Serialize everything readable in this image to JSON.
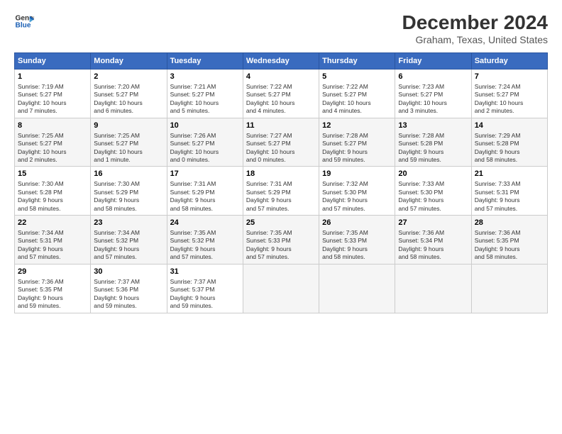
{
  "logo": {
    "line1": "General",
    "line2": "Blue"
  },
  "title": "December 2024",
  "subtitle": "Graham, Texas, United States",
  "days_of_week": [
    "Sunday",
    "Monday",
    "Tuesday",
    "Wednesday",
    "Thursday",
    "Friday",
    "Saturday"
  ],
  "weeks": [
    [
      {
        "day": "1",
        "info": "Sunrise: 7:19 AM\nSunset: 5:27 PM\nDaylight: 10 hours\nand 7 minutes."
      },
      {
        "day": "2",
        "info": "Sunrise: 7:20 AM\nSunset: 5:27 PM\nDaylight: 10 hours\nand 6 minutes."
      },
      {
        "day": "3",
        "info": "Sunrise: 7:21 AM\nSunset: 5:27 PM\nDaylight: 10 hours\nand 5 minutes."
      },
      {
        "day": "4",
        "info": "Sunrise: 7:22 AM\nSunset: 5:27 PM\nDaylight: 10 hours\nand 4 minutes."
      },
      {
        "day": "5",
        "info": "Sunrise: 7:22 AM\nSunset: 5:27 PM\nDaylight: 10 hours\nand 4 minutes."
      },
      {
        "day": "6",
        "info": "Sunrise: 7:23 AM\nSunset: 5:27 PM\nDaylight: 10 hours\nand 3 minutes."
      },
      {
        "day": "7",
        "info": "Sunrise: 7:24 AM\nSunset: 5:27 PM\nDaylight: 10 hours\nand 2 minutes."
      }
    ],
    [
      {
        "day": "8",
        "info": "Sunrise: 7:25 AM\nSunset: 5:27 PM\nDaylight: 10 hours\nand 2 minutes."
      },
      {
        "day": "9",
        "info": "Sunrise: 7:25 AM\nSunset: 5:27 PM\nDaylight: 10 hours\nand 1 minute."
      },
      {
        "day": "10",
        "info": "Sunrise: 7:26 AM\nSunset: 5:27 PM\nDaylight: 10 hours\nand 0 minutes."
      },
      {
        "day": "11",
        "info": "Sunrise: 7:27 AM\nSunset: 5:27 PM\nDaylight: 10 hours\nand 0 minutes."
      },
      {
        "day": "12",
        "info": "Sunrise: 7:28 AM\nSunset: 5:27 PM\nDaylight: 9 hours\nand 59 minutes."
      },
      {
        "day": "13",
        "info": "Sunrise: 7:28 AM\nSunset: 5:28 PM\nDaylight: 9 hours\nand 59 minutes."
      },
      {
        "day": "14",
        "info": "Sunrise: 7:29 AM\nSunset: 5:28 PM\nDaylight: 9 hours\nand 58 minutes."
      }
    ],
    [
      {
        "day": "15",
        "info": "Sunrise: 7:30 AM\nSunset: 5:28 PM\nDaylight: 9 hours\nand 58 minutes."
      },
      {
        "day": "16",
        "info": "Sunrise: 7:30 AM\nSunset: 5:29 PM\nDaylight: 9 hours\nand 58 minutes."
      },
      {
        "day": "17",
        "info": "Sunrise: 7:31 AM\nSunset: 5:29 PM\nDaylight: 9 hours\nand 58 minutes."
      },
      {
        "day": "18",
        "info": "Sunrise: 7:31 AM\nSunset: 5:29 PM\nDaylight: 9 hours\nand 57 minutes."
      },
      {
        "day": "19",
        "info": "Sunrise: 7:32 AM\nSunset: 5:30 PM\nDaylight: 9 hours\nand 57 minutes."
      },
      {
        "day": "20",
        "info": "Sunrise: 7:33 AM\nSunset: 5:30 PM\nDaylight: 9 hours\nand 57 minutes."
      },
      {
        "day": "21",
        "info": "Sunrise: 7:33 AM\nSunset: 5:31 PM\nDaylight: 9 hours\nand 57 minutes."
      }
    ],
    [
      {
        "day": "22",
        "info": "Sunrise: 7:34 AM\nSunset: 5:31 PM\nDaylight: 9 hours\nand 57 minutes."
      },
      {
        "day": "23",
        "info": "Sunrise: 7:34 AM\nSunset: 5:32 PM\nDaylight: 9 hours\nand 57 minutes."
      },
      {
        "day": "24",
        "info": "Sunrise: 7:35 AM\nSunset: 5:32 PM\nDaylight: 9 hours\nand 57 minutes."
      },
      {
        "day": "25",
        "info": "Sunrise: 7:35 AM\nSunset: 5:33 PM\nDaylight: 9 hours\nand 57 minutes."
      },
      {
        "day": "26",
        "info": "Sunrise: 7:35 AM\nSunset: 5:33 PM\nDaylight: 9 hours\nand 58 minutes."
      },
      {
        "day": "27",
        "info": "Sunrise: 7:36 AM\nSunset: 5:34 PM\nDaylight: 9 hours\nand 58 minutes."
      },
      {
        "day": "28",
        "info": "Sunrise: 7:36 AM\nSunset: 5:35 PM\nDaylight: 9 hours\nand 58 minutes."
      }
    ],
    [
      {
        "day": "29",
        "info": "Sunrise: 7:36 AM\nSunset: 5:35 PM\nDaylight: 9 hours\nand 59 minutes."
      },
      {
        "day": "30",
        "info": "Sunrise: 7:37 AM\nSunset: 5:36 PM\nDaylight: 9 hours\nand 59 minutes."
      },
      {
        "day": "31",
        "info": "Sunrise: 7:37 AM\nSunset: 5:37 PM\nDaylight: 9 hours\nand 59 minutes."
      },
      null,
      null,
      null,
      null
    ]
  ]
}
